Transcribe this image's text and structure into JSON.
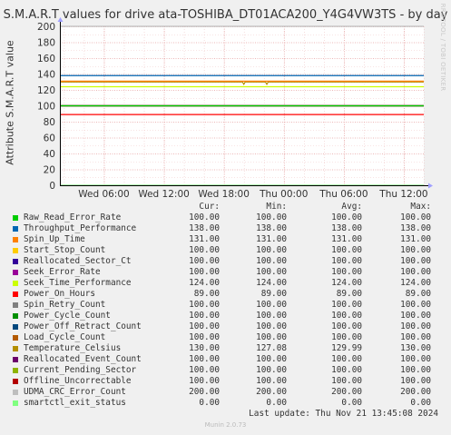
{
  "chart_data": {
    "type": "line",
    "title": "S.M.A.R.T values for drive ata-TOSHIBA_DT01ACA200_Y4G4VW3TS - by day",
    "ylabel": "Attribute S.M.A.R.T value",
    "ylim": [
      0,
      200
    ],
    "yticks": [
      0,
      20,
      40,
      60,
      80,
      100,
      120,
      140,
      160,
      180,
      200
    ],
    "xticks": [
      "Wed 06:00",
      "Wed 12:00",
      "Wed 18:00",
      "Thu 00:00",
      "Thu 06:00",
      "Thu 12:00"
    ],
    "xtick_hours": [
      6,
      12,
      18,
      24,
      30,
      36
    ],
    "xlim_hours": [
      1.6,
      38.0
    ],
    "grid": true,
    "series": [
      {
        "name": "Raw_Read_Error_Rate",
        "color": "#00cc00",
        "values": [
          100,
          100
        ]
      },
      {
        "name": "Throughput_Performance",
        "color": "#0066b3",
        "values": [
          138,
          138
        ]
      },
      {
        "name": "Spin_Up_Time",
        "color": "#ff8000",
        "values": [
          131,
          131
        ]
      },
      {
        "name": "Start_Stop_Count",
        "color": "#ffcc00",
        "values": [
          100,
          100
        ]
      },
      {
        "name": "Reallocated_Sector_Ct",
        "color": "#330099",
        "values": [
          100,
          100
        ]
      },
      {
        "name": "Seek_Error_Rate",
        "color": "#990099",
        "values": [
          100,
          100
        ]
      },
      {
        "name": "Seek_Time_Performance",
        "color": "#ccff00",
        "values": [
          124,
          124
        ]
      },
      {
        "name": "Power_On_Hours",
        "color": "#ff0000",
        "values": [
          89,
          89
        ]
      },
      {
        "name": "Spin_Retry_Count",
        "color": "#808080",
        "values": [
          100,
          100
        ]
      },
      {
        "name": "Power_Cycle_Count",
        "color": "#008f00",
        "values": [
          100,
          100
        ]
      },
      {
        "name": "Power_Off_Retract_Count",
        "color": "#00487d",
        "values": [
          100,
          100
        ]
      },
      {
        "name": "Load_Cycle_Count",
        "color": "#b35a00",
        "values": [
          100,
          100
        ]
      },
      {
        "name": "Temperature_Celsius",
        "color": "#b38f00",
        "values": [
          130,
          130
        ],
        "dips": [
          [
            20,
            127.08
          ],
          [
            22.3,
            127.08
          ]
        ]
      },
      {
        "name": "Reallocated_Event_Count",
        "color": "#6b006b",
        "values": [
          100,
          100
        ]
      },
      {
        "name": "Current_Pending_Sector",
        "color": "#8fb300",
        "values": [
          100,
          100
        ]
      },
      {
        "name": "Offline_Uncorrectable",
        "color": "#b30000",
        "values": [
          100,
          100
        ]
      },
      {
        "name": "UDMA_CRC_Error_Count",
        "color": "#bebebe",
        "values": [
          200,
          200
        ]
      },
      {
        "name": "smartctl_exit_status",
        "color": "#80ff80",
        "values": [
          0,
          0
        ]
      }
    ]
  },
  "legend": {
    "headers": [
      "Cur:",
      "Min:",
      "Avg:",
      "Max:"
    ],
    "rows": [
      {
        "name": "Raw_Read_Error_Rate",
        "cur": "100.00",
        "min": "100.00",
        "avg": "100.00",
        "max": "100.00"
      },
      {
        "name": "Throughput_Performance",
        "cur": "138.00",
        "min": "138.00",
        "avg": "138.00",
        "max": "138.00"
      },
      {
        "name": "Spin_Up_Time",
        "cur": "131.00",
        "min": "131.00",
        "avg": "131.00",
        "max": "131.00"
      },
      {
        "name": "Start_Stop_Count",
        "cur": "100.00",
        "min": "100.00",
        "avg": "100.00",
        "max": "100.00"
      },
      {
        "name": "Reallocated_Sector_Ct",
        "cur": "100.00",
        "min": "100.00",
        "avg": "100.00",
        "max": "100.00"
      },
      {
        "name": "Seek_Error_Rate",
        "cur": "100.00",
        "min": "100.00",
        "avg": "100.00",
        "max": "100.00"
      },
      {
        "name": "Seek_Time_Performance",
        "cur": "124.00",
        "min": "124.00",
        "avg": "124.00",
        "max": "124.00"
      },
      {
        "name": "Power_On_Hours",
        "cur": "89.00",
        "min": "89.00",
        "avg": "89.00",
        "max": "89.00"
      },
      {
        "name": "Spin_Retry_Count",
        "cur": "100.00",
        "min": "100.00",
        "avg": "100.00",
        "max": "100.00"
      },
      {
        "name": "Power_Cycle_Count",
        "cur": "100.00",
        "min": "100.00",
        "avg": "100.00",
        "max": "100.00"
      },
      {
        "name": "Power_Off_Retract_Count",
        "cur": "100.00",
        "min": "100.00",
        "avg": "100.00",
        "max": "100.00"
      },
      {
        "name": "Load_Cycle_Count",
        "cur": "100.00",
        "min": "100.00",
        "avg": "100.00",
        "max": "100.00"
      },
      {
        "name": "Temperature_Celsius",
        "cur": "130.00",
        "min": "127.08",
        "avg": "129.99",
        "max": "130.00"
      },
      {
        "name": "Reallocated_Event_Count",
        "cur": "100.00",
        "min": "100.00",
        "avg": "100.00",
        "max": "100.00"
      },
      {
        "name": "Current_Pending_Sector",
        "cur": "100.00",
        "min": "100.00",
        "avg": "100.00",
        "max": "100.00"
      },
      {
        "name": "Offline_Uncorrectable",
        "cur": "100.00",
        "min": "100.00",
        "avg": "100.00",
        "max": "100.00"
      },
      {
        "name": "UDMA_CRC_Error_Count",
        "cur": "200.00",
        "min": "200.00",
        "avg": "200.00",
        "max": "200.00"
      },
      {
        "name": "smartctl_exit_status",
        "cur": "0.00",
        "min": "0.00",
        "avg": "0.00",
        "max": "0.00"
      }
    ]
  },
  "last_update": "Last update: Thu Nov 21 13:45:08 2024",
  "footer": "Munin 2.0.73",
  "watermark": "RRDTOOL / TOBI OETIKER"
}
